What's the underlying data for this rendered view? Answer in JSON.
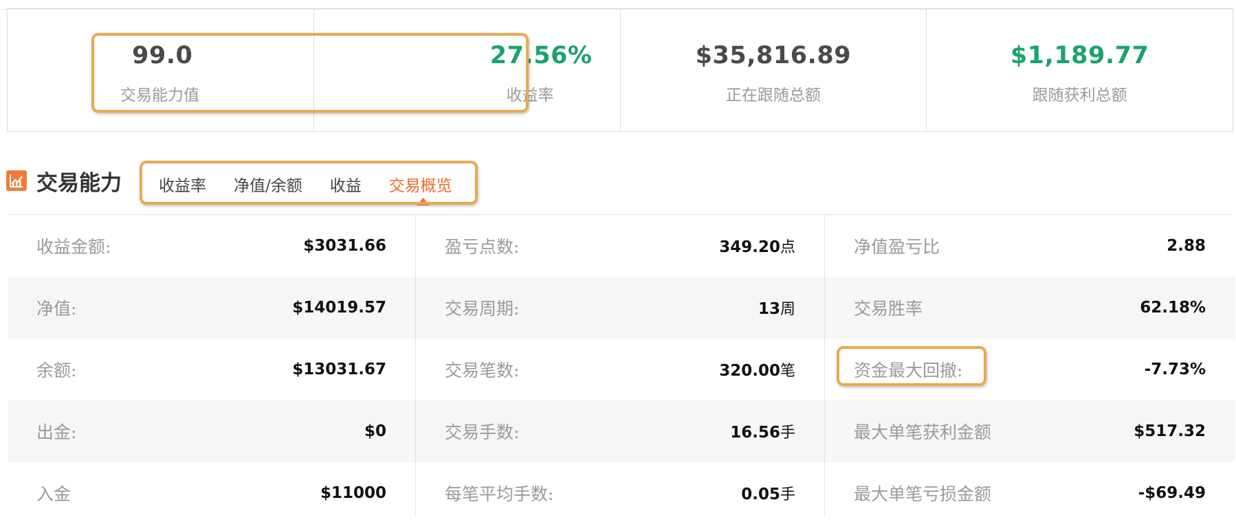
{
  "stats": [
    {
      "value": "99.0",
      "label": "交易能力值",
      "color": "#4a4a4a"
    },
    {
      "value": "27.56%",
      "label": "收益率",
      "color": "#1aa36b"
    },
    {
      "value": "$35,816.89",
      "label": "正在跟随总额",
      "color": "#4a4a4a"
    },
    {
      "value": "$1,189.77",
      "label": "跟随获利总额",
      "color": "#1aa36b"
    }
  ],
  "section": {
    "title": "交易能力",
    "icon": "chart-icon",
    "tabs": [
      "收益率",
      "净值/余额",
      "收益",
      "交易概览"
    ],
    "active_tab": "交易概览"
  },
  "overview": {
    "col1": [
      {
        "label": "收益金额:",
        "value": "$3031.66",
        "unit": ""
      },
      {
        "label": "净值:",
        "value": "$14019.57",
        "unit": ""
      },
      {
        "label": "余额:",
        "value": "$13031.67",
        "unit": ""
      },
      {
        "label": "出金:",
        "value": "$0",
        "unit": ""
      },
      {
        "label": "入金",
        "value": "$11000",
        "unit": ""
      }
    ],
    "col2": [
      {
        "label": "盈亏点数:",
        "value": "349.20",
        "unit": "点"
      },
      {
        "label": "交易周期:",
        "value": "13",
        "unit": "周"
      },
      {
        "label": "交易笔数:",
        "value": "320.00",
        "unit": "笔"
      },
      {
        "label": "交易手数:",
        "value": "16.56",
        "unit": "手"
      },
      {
        "label": "每笔平均手数:",
        "value": "0.05",
        "unit": "手"
      }
    ],
    "col3": [
      {
        "label": "净值盈亏比",
        "value": "2.88",
        "unit": ""
      },
      {
        "label": "交易胜率",
        "value": "62.18%",
        "unit": ""
      },
      {
        "label": "资金最大回撤:",
        "value": "-7.73%",
        "unit": ""
      },
      {
        "label": "最大单笔获利金额",
        "value": "$517.32",
        "unit": ""
      },
      {
        "label": "最大单笔亏损金额",
        "value": "-$69.49",
        "unit": ""
      }
    ]
  },
  "colors": {
    "accent": "#ee6b27",
    "positive": "#1aa36b",
    "highlight": "#e7aa4f"
  }
}
